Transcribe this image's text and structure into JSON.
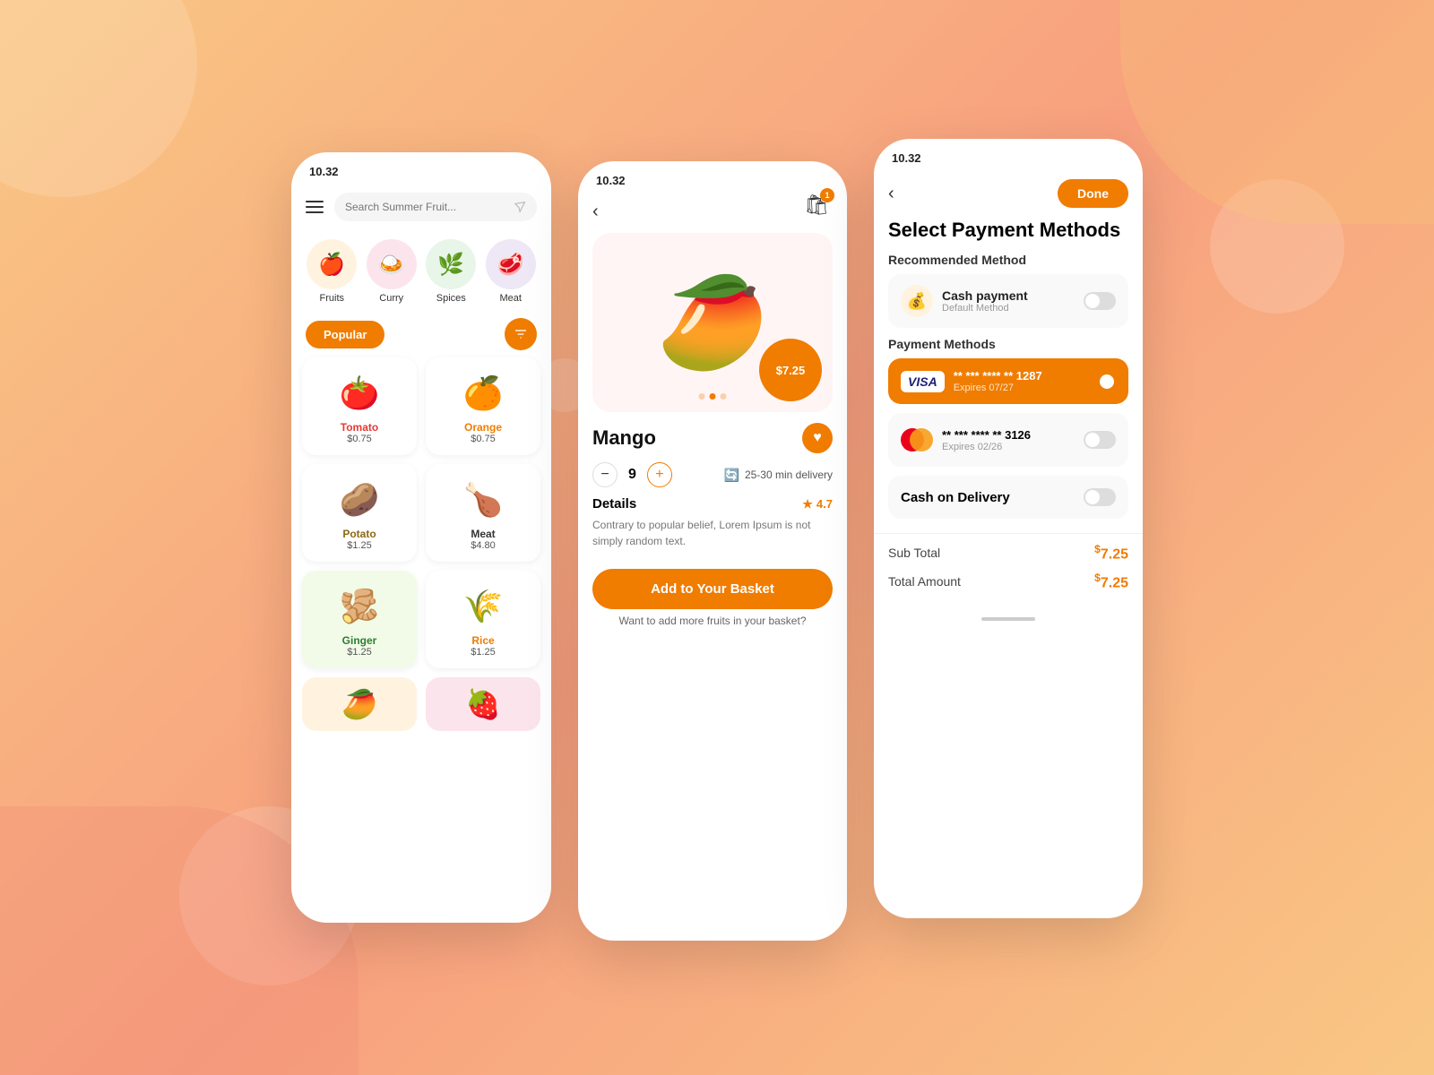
{
  "background": {
    "color_start": "#f9c784",
    "color_end": "#f8a07e"
  },
  "phone1": {
    "status_time": "10.32",
    "search_placeholder": "Search Summer Fruit...",
    "categories": [
      {
        "id": "fruits",
        "label": "Fruits",
        "emoji": "🍎",
        "bg": "cat-fruits"
      },
      {
        "id": "curry",
        "label": "Curry",
        "emoji": "🍛",
        "bg": "cat-curry"
      },
      {
        "id": "spices",
        "label": "Spices",
        "emoji": "🌿",
        "bg": "cat-spices"
      },
      {
        "id": "meat",
        "label": "Meat",
        "emoji": "🥩",
        "bg": "cat-meat"
      }
    ],
    "popular_label": "Popular",
    "products": [
      {
        "id": "tomato",
        "name": "Tomato",
        "price": "$0.75",
        "emoji": "🍅",
        "name_class": "tomato"
      },
      {
        "id": "orange",
        "name": "Orange",
        "price": "$0.75",
        "emoji": "🍊",
        "name_class": "orange"
      },
      {
        "id": "potato",
        "name": "Potato",
        "price": "$1.25",
        "emoji": "🥔",
        "name_class": "potato"
      },
      {
        "id": "meat",
        "name": "Meat",
        "price": "$4.80",
        "emoji": "🍗",
        "name_class": "meat"
      },
      {
        "id": "ginger",
        "name": "Ginger",
        "price": "$1.25",
        "emoji": "🫚",
        "name_class": "ginger"
      },
      {
        "id": "rice",
        "name": "Rice",
        "price": "$1.25",
        "emoji": "🌾",
        "name_class": "rice"
      }
    ],
    "bottom_items": [
      {
        "id": "mango-partial",
        "emoji": "🥭",
        "bg": "partial-mango"
      },
      {
        "id": "berry-partial",
        "emoji": "🍓",
        "bg": "partial-berry"
      }
    ]
  },
  "phone2": {
    "status_time": "10.32",
    "basket_count": "1",
    "product_emoji": "🥭",
    "price": "$7.25",
    "product_name": "Mango",
    "quantity": "9",
    "delivery_time": "25-30 min delivery",
    "rating": "4.7",
    "details_title": "Details",
    "details_text": "Contrary to popular belief, Lorem Ipsum is not simply random text.",
    "add_basket_label": "Add to Your Basket",
    "more_fruits_text": "Want to add more fruits in your basket?",
    "dots": [
      false,
      true,
      false
    ]
  },
  "phone3": {
    "status_time": "10.32",
    "done_label": "Done",
    "title": "Select Payment Methods",
    "recommended_label": "Recommended Method",
    "recommended": {
      "name": "Cash payment",
      "sub": "Default Method"
    },
    "payment_methods_label": "Payment Methods",
    "cards": [
      {
        "type": "visa",
        "number": "** *** **** ** 1287",
        "expiry": "Expires 07/27",
        "active": true
      },
      {
        "type": "mastercard",
        "number": "** *** **** ** 3126",
        "expiry": "Expires 02/26",
        "active": false
      }
    ],
    "cod_label": "Cash on Delivery",
    "subtotal_label": "Sub Total",
    "subtotal_value": "7.25",
    "total_label": "Total Amount",
    "total_value": "7.25"
  }
}
